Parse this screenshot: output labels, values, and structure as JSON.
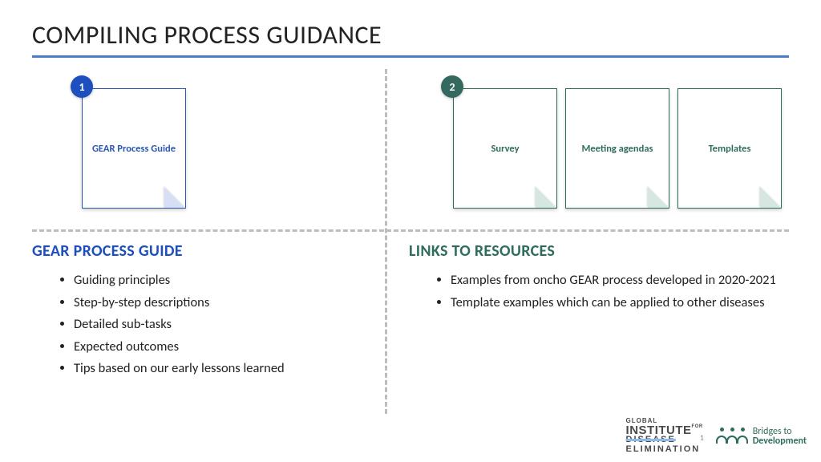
{
  "title": "COMPILING PROCESS GUIDANCE",
  "badges": {
    "one": "1",
    "two": "2"
  },
  "docs": {
    "guide": "GEAR Process Guide",
    "survey": "Survey",
    "agendas": "Meeting agendas",
    "templates": "Templates"
  },
  "left": {
    "heading": "GEAR PROCESS GUIDE",
    "items": [
      "Guiding principles",
      "Step-by-step descriptions",
      "Detailed sub-tasks",
      "Expected outcomes",
      "Tips based on our early lessons learned"
    ]
  },
  "right": {
    "heading": "LINKS TO RESOURCES",
    "items": [
      "Examples from oncho GEAR process developed in 2020-2021",
      "Template examples which can be applied to other diseases"
    ]
  },
  "footer": {
    "gide_l1": "GLOBAL",
    "gide_l2_a": "INSTITUTE",
    "gide_l2_b": "FOR",
    "gide_strike": "DISEASE",
    "gide_l3": "ELIMINATION",
    "bridges_l1": "Bridges to",
    "bridges_l2": "Development",
    "pagenum": "1"
  }
}
